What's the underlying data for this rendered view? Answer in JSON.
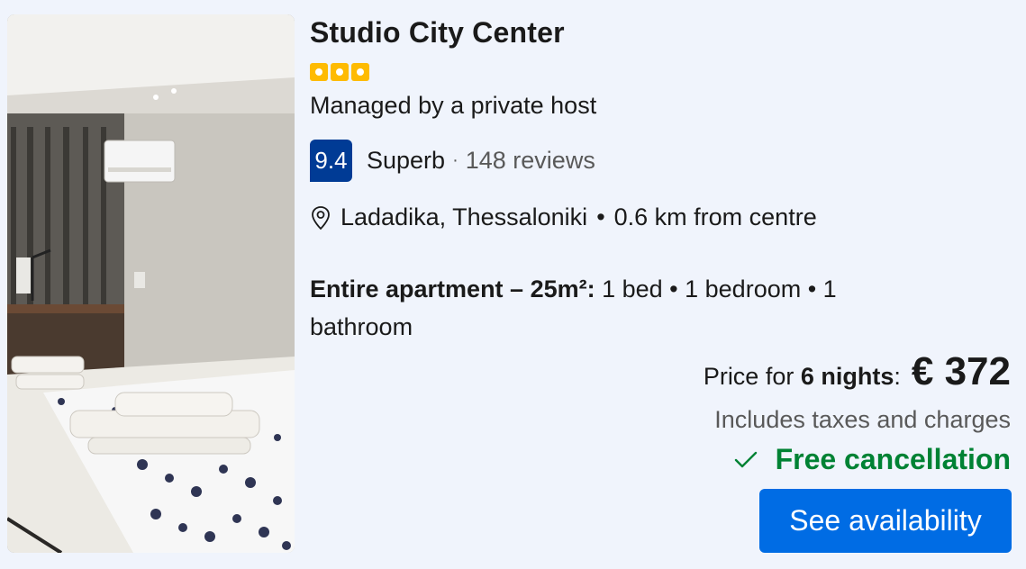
{
  "property": {
    "name": "Studio City Center",
    "star_rating_dots": 3,
    "host": "Managed by a private host"
  },
  "rating": {
    "score": "9.4",
    "label": "Superb",
    "separator": "·",
    "reviews": "148 reviews"
  },
  "location": {
    "icon": "map-pin-icon",
    "area": "Ladadika, Thessaloniki",
    "bullet": "•",
    "distance": "0.6 km from centre"
  },
  "unit": {
    "type": "Entire apartment – 25m²:",
    "details": "1 bed • 1 bedroom • 1 bathroom"
  },
  "pricing": {
    "prefix": "Price for",
    "nights": "6 nights",
    "colon": ":",
    "price": "€ 372",
    "taxes": "Includes taxes and charges"
  },
  "cancellation": {
    "icon": "checkmark-icon",
    "label": "Free cancellation"
  },
  "actions": {
    "availability_label": "See availability"
  },
  "colors": {
    "score_bg": "#003b95",
    "accent_blue": "#006ce4",
    "star_yellow": "#febb02",
    "success_green": "#008234",
    "page_bg": "#f0f4fc"
  }
}
